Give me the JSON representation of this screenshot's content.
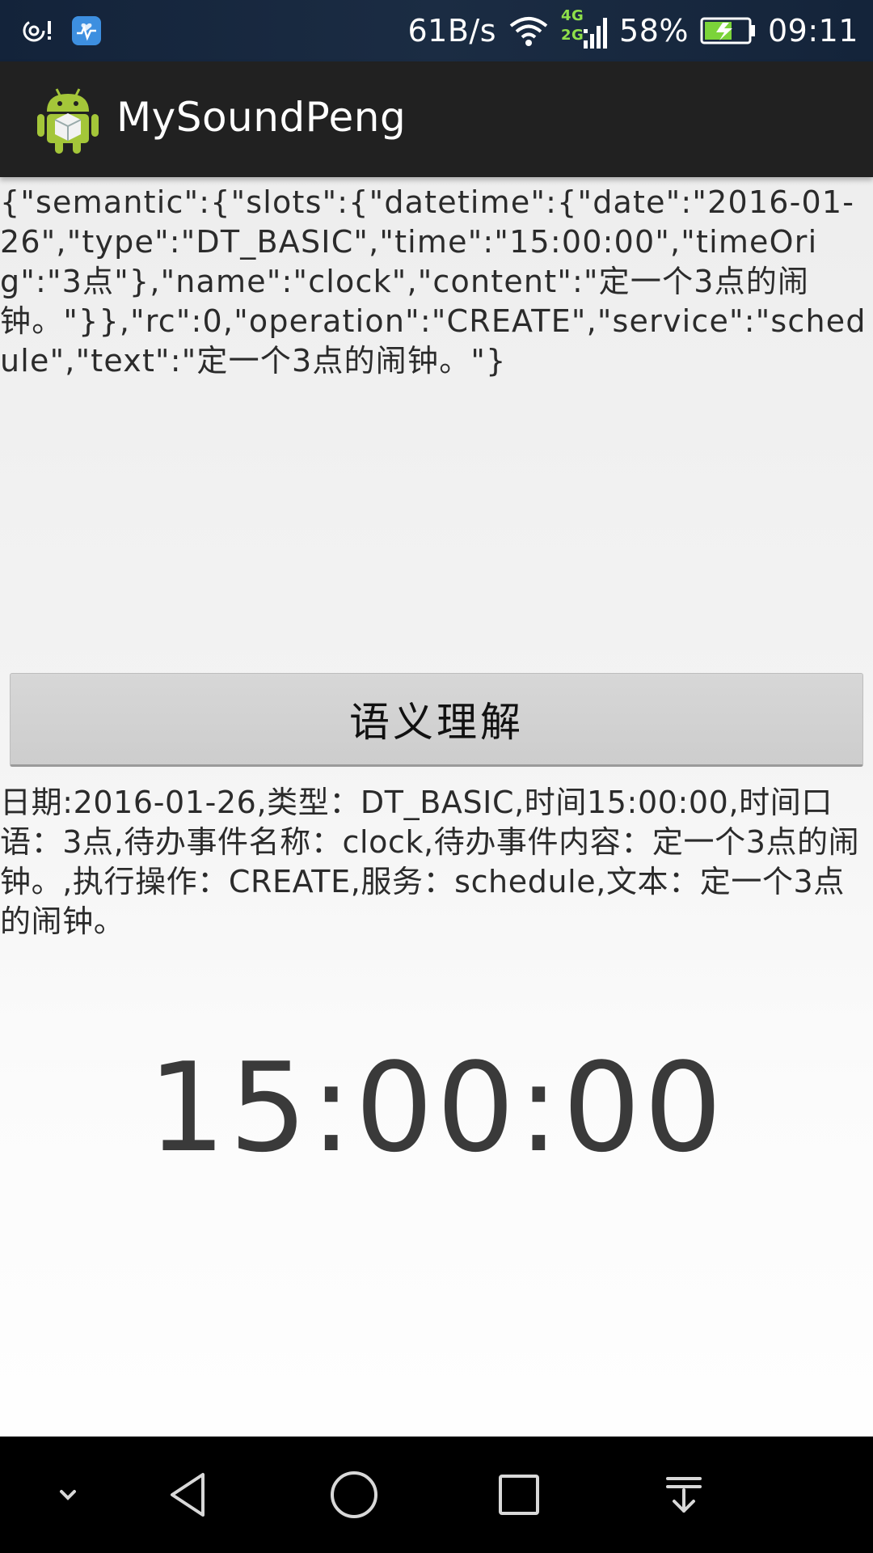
{
  "status_bar": {
    "network_speed": "61B/s",
    "network_type_top": "4G",
    "network_type_bottom": "2G",
    "battery_percent": "58%",
    "time": "09:11",
    "icons": [
      "hotspot-icon",
      "health-app-icon",
      "wifi-icon",
      "signal-icon",
      "battery-charging-icon"
    ]
  },
  "action_bar": {
    "title": "MySoundPeng",
    "icon": "android-app-icon"
  },
  "content": {
    "json_result": "{\"semantic\":{\"slots\":{\"datetime\":{\"date\":\"2016-01-26\",\"type\":\"DT_BASIC\",\"time\":\"15:00:00\",\"timeOrig\":\"3点\"},\"name\":\"clock\",\"content\":\"定一个3点的闹钟。\"}},\"rc\":0,\"operation\":\"CREATE\",\"service\":\"schedule\",\"text\":\"定一个3点的闹钟。\"}",
    "button_label": "语义理解",
    "parsed_result": "日期:2016-01-26,类型：DT_BASIC,时间15:00:00,时间口语：3点,待办事件名称：clock,待办事件内容：定一个3点的闹钟。,执行操作：CREATE,服务：schedule,文本：定一个3点的闹钟。",
    "big_time": "15:00:00"
  },
  "nav_bar": {
    "buttons": [
      "hide-nav-icon",
      "back-icon",
      "home-icon",
      "recents-icon",
      "notification-pull-icon"
    ]
  }
}
